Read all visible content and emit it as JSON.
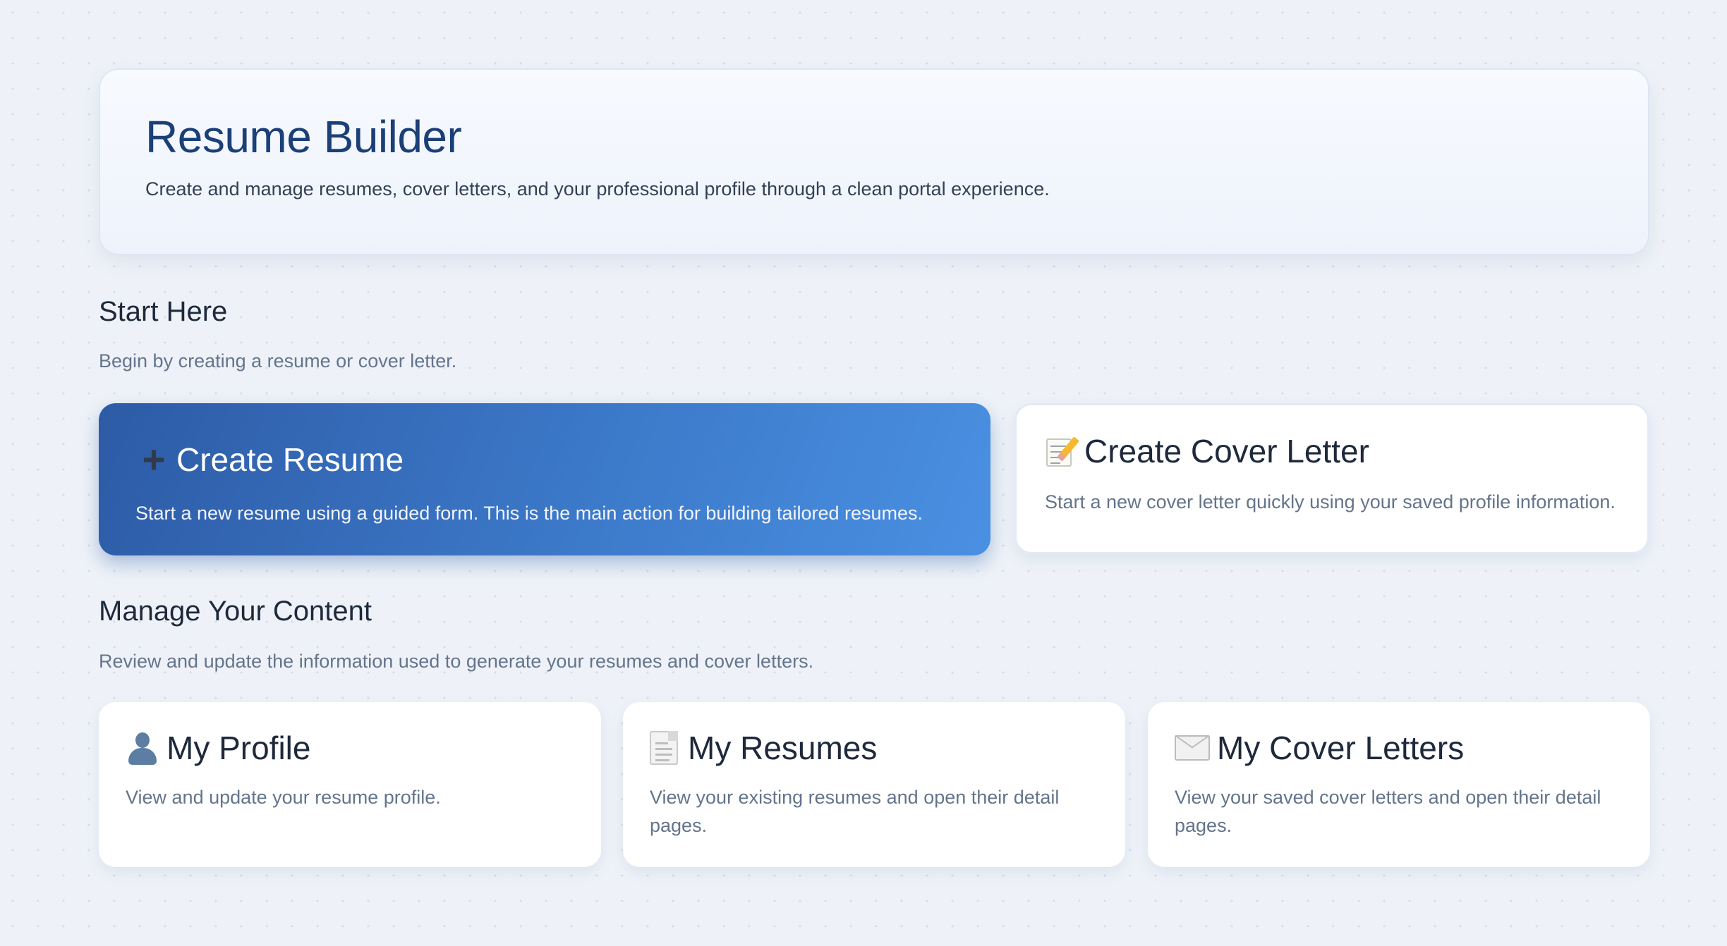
{
  "header": {
    "title": "Resume Builder",
    "subtitle": "Create and manage resumes, cover letters, and your professional profile through a clean portal experience."
  },
  "start": {
    "title": "Start Here",
    "subtitle": "Begin by creating a resume or cover letter.",
    "primary_card": {
      "icon": "plus-icon",
      "glyph": "+",
      "title": "Create Resume",
      "description": "Start a new resume using a guided form. This is the main action for building tailored resumes."
    },
    "secondary_card": {
      "icon": "memo-icon",
      "title": "Create Cover Letter",
      "description": "Start a new cover letter quickly using your saved profile information."
    }
  },
  "manage": {
    "title": "Manage Your Content",
    "subtitle": "Review and update the information used to generate your resumes and cover letters.",
    "cards": [
      {
        "icon": "person-icon",
        "title": "My Profile",
        "description": "View and update your resume profile."
      },
      {
        "icon": "document-icon",
        "title": "My Resumes",
        "description": "View your existing resumes and open their detail pages."
      },
      {
        "icon": "envelope-icon",
        "title": "My Cover Letters",
        "description": "View your saved cover letters and open their detail pages."
      }
    ]
  },
  "colors": {
    "background": "#eef2f8",
    "title_blue": "#1b3f78",
    "primary_gradient_start": "#2d5ba6",
    "primary_gradient_end": "#4a90e2",
    "muted_text": "#64748b"
  }
}
